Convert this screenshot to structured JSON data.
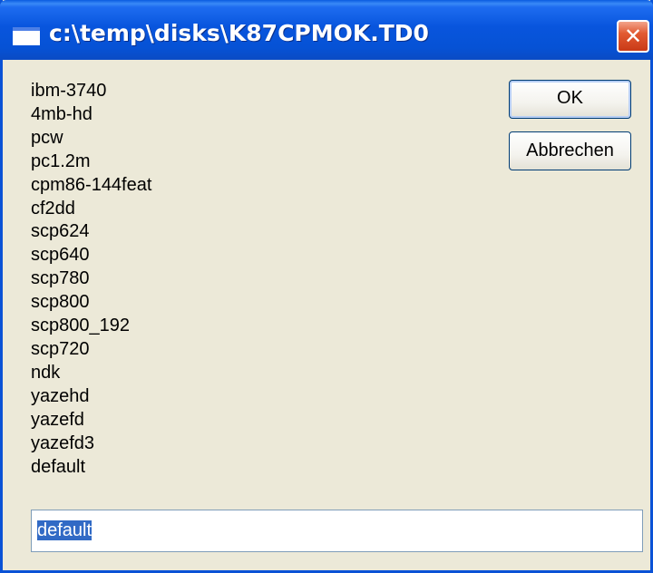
{
  "window": {
    "title": "c:\\temp\\disks\\K87CPMOK.TD0",
    "close_glyph": "✕"
  },
  "format_list": [
    "ibm-3740",
    "4mb-hd",
    "pcw",
    "pc1.2m",
    "cpm86-144feat",
    "cf2dd",
    "scp624",
    "scp640",
    "scp780",
    "scp800",
    "scp800_192",
    "scp720",
    "ndk",
    "yazehd",
    "yazefd",
    "yazefd3",
    "default"
  ],
  "buttons": {
    "ok_label": "OK",
    "cancel_label": "Abbrechen"
  },
  "input": {
    "value": "default"
  },
  "colors": {
    "titlebar": "#0855DD",
    "window_bg": "#ECE9D8",
    "close_button": "#E25A32",
    "selection": "#316AC5"
  }
}
